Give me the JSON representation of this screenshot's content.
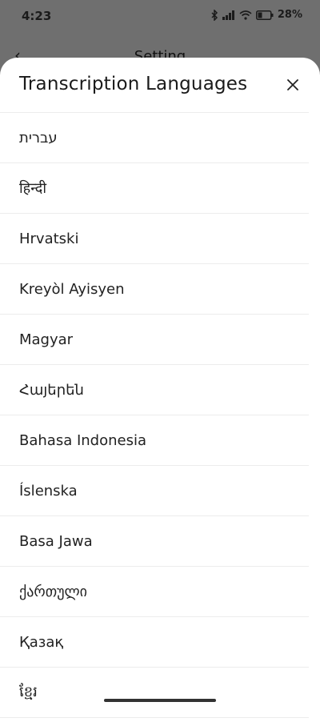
{
  "status_bar": {
    "time": "4:23",
    "battery": "28%"
  },
  "background": {
    "title": "Setting",
    "back_icon": "chevron-left-icon"
  },
  "sheet": {
    "title": "Transcription Languages",
    "close_icon": "close-icon",
    "languages": [
      "עברית",
      "हिन्दी",
      "Hrvatski",
      "Kreyòl Ayisyen",
      "Magyar",
      "Հայերեն",
      "Bahasa Indonesia",
      "Íslenska",
      "Basa Jawa",
      "ქართული",
      "Қазақ",
      "ខ្មែរ"
    ]
  }
}
